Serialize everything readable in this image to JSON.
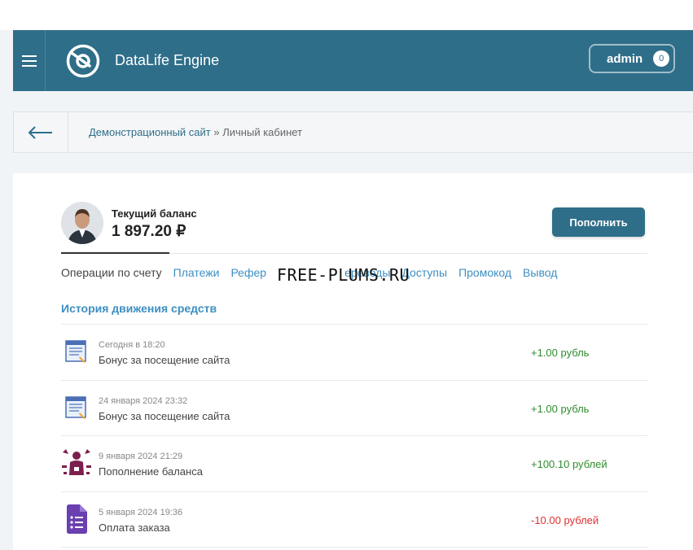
{
  "header": {
    "brand": "DataLife Engine",
    "user_name": "admin",
    "user_count": "0"
  },
  "breadcrumb": {
    "site_link": "Демонстрационный сайт",
    "separator": " » ",
    "current": "Личный кабинет"
  },
  "account": {
    "balance_label": "Текущий баланс",
    "balance_value": "1 897.20 ₽",
    "topup_label": "Пополнить"
  },
  "tabs": [
    {
      "label": "Операции по счету",
      "active": true
    },
    {
      "label": "Платежи"
    },
    {
      "label": "Рефер"
    },
    {
      "label": "ереводы"
    },
    {
      "label": "Доступы"
    },
    {
      "label": "Промокод"
    },
    {
      "label": "Вывод"
    }
  ],
  "watermark": "FREE-PLUMS.RU",
  "history": {
    "title": "История движения средств",
    "rows": [
      {
        "icon": "document-icon",
        "date": "Сегодня в 18:20",
        "desc": "Бонус за посещение сайта",
        "amount": "+1.00 рубль",
        "type": "pos"
      },
      {
        "icon": "document-icon",
        "date": "24 января 2024 23:32",
        "desc": "Бонус за посещение сайта",
        "amount": "+1.00 рубль",
        "type": "pos"
      },
      {
        "icon": "person-icon",
        "date": "9 января 2024 21:29",
        "desc": "Пополнение баланса",
        "amount": "+100.10 рублей",
        "type": "pos"
      },
      {
        "icon": "form-icon",
        "date": "5 января 2024 19:36",
        "desc": "Оплата заказа",
        "amount": "-10.00 рублей",
        "type": "neg"
      }
    ]
  },
  "colors": {
    "header_bg": "#2f6e89",
    "link": "#3d8fc2",
    "positive": "#2e8b2e",
    "negative": "#e03030"
  }
}
